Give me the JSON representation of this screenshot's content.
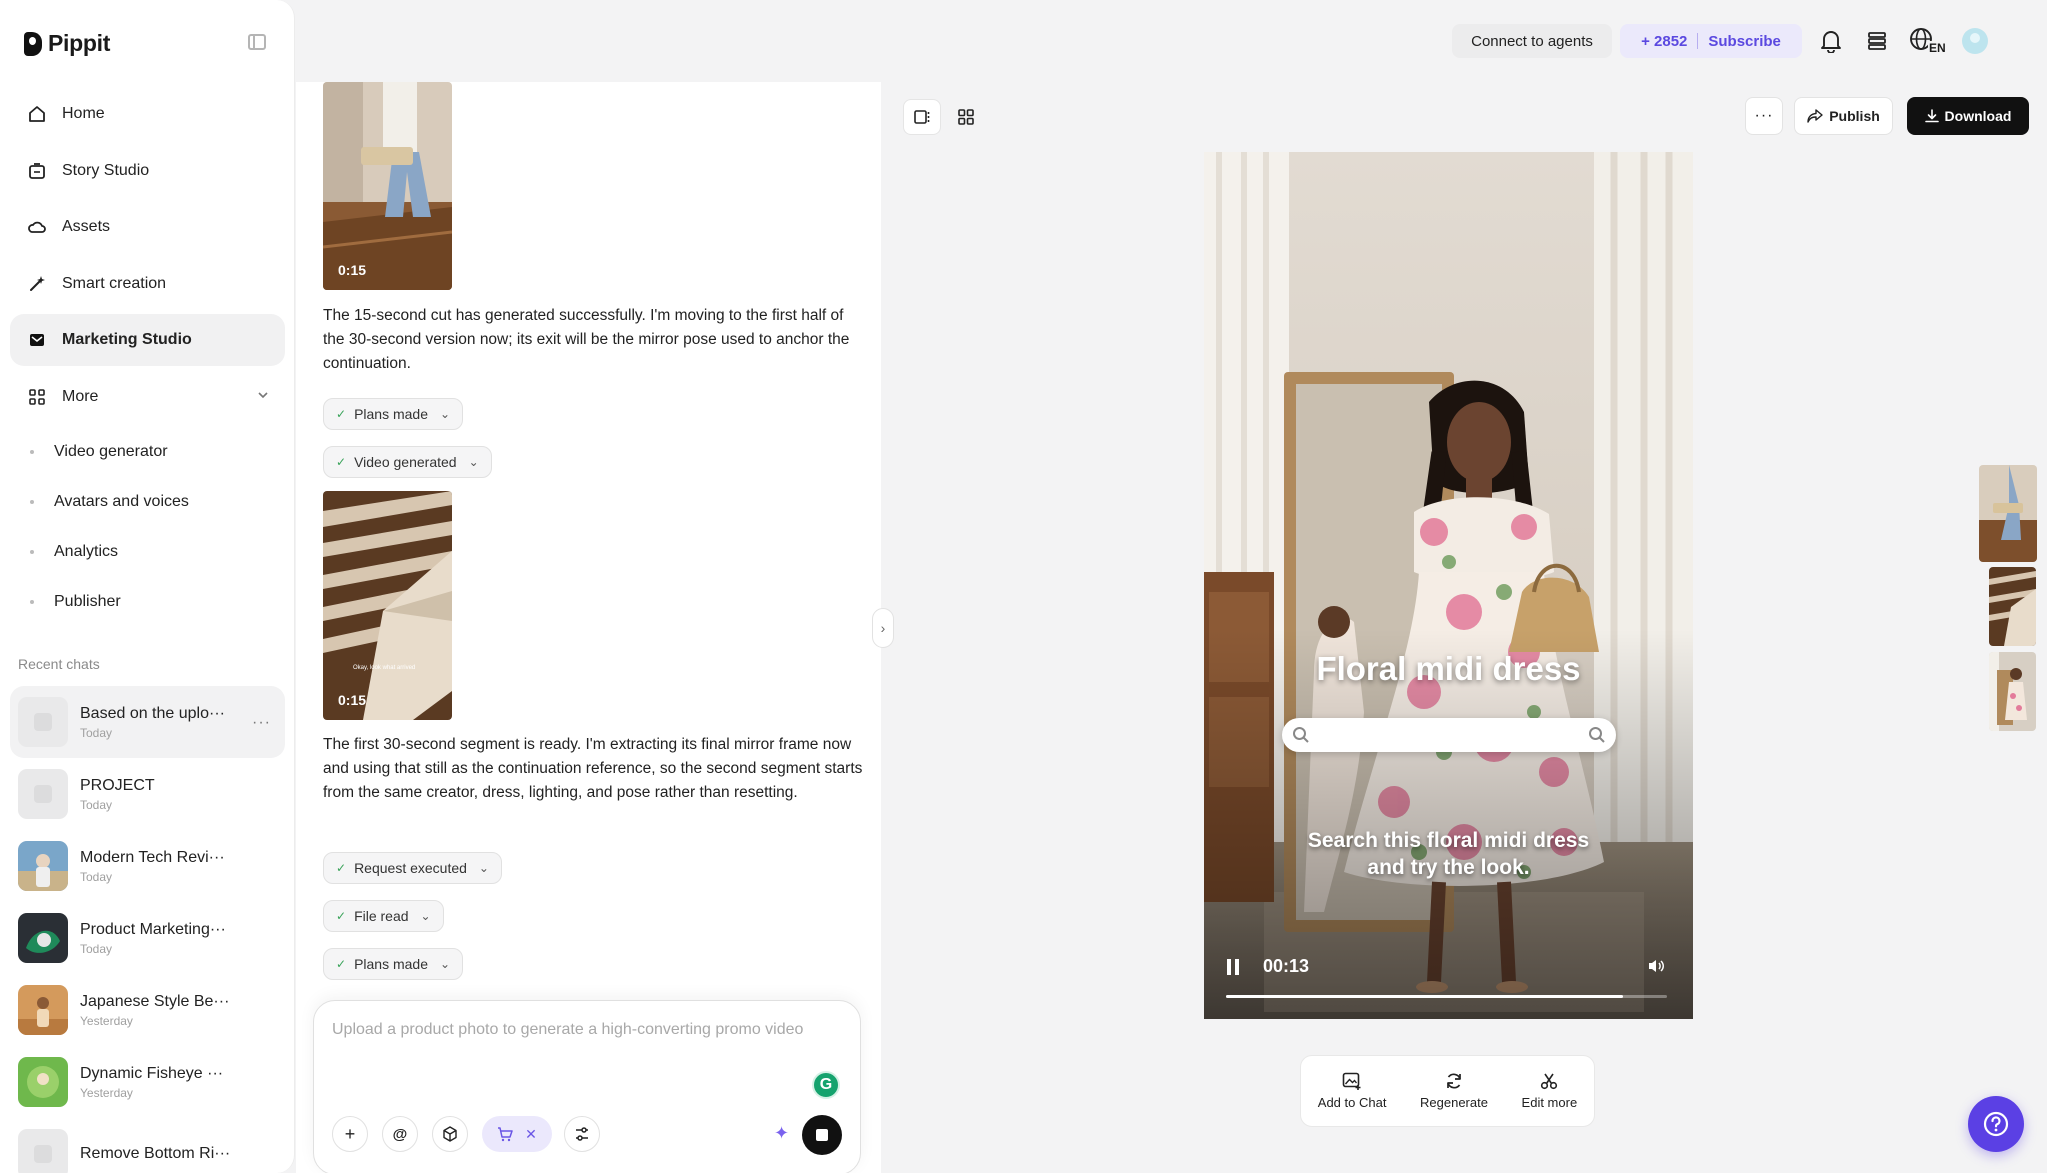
{
  "app": {
    "name": "Pippit"
  },
  "sidebar": {
    "items": [
      {
        "label": "Home",
        "icon": "home-icon"
      },
      {
        "label": "Story Studio",
        "icon": "story-icon"
      },
      {
        "label": "Assets",
        "icon": "cloud-icon"
      },
      {
        "label": "Smart creation",
        "icon": "magic-wand-icon"
      },
      {
        "label": "Marketing Studio",
        "icon": "mail-icon",
        "active": true
      },
      {
        "label": "More",
        "icon": "grid-icon"
      }
    ],
    "subitems": [
      {
        "label": "Video generator"
      },
      {
        "label": "Avatars and voices"
      },
      {
        "label": "Analytics"
      },
      {
        "label": "Publisher"
      }
    ],
    "recent_label": "Recent chats",
    "recent_chats": [
      {
        "title": "Based on the uplo···",
        "date": "Today",
        "active": true
      },
      {
        "title": "PROJECT",
        "date": "Today"
      },
      {
        "title": "Modern Tech Revi···",
        "date": "Today"
      },
      {
        "title": "Product Marketing···",
        "date": "Today"
      },
      {
        "title": "Japanese Style Be···",
        "date": "Yesterday"
      },
      {
        "title": "Dynamic Fisheye ···",
        "date": "Yesterday"
      },
      {
        "title": "Remove Bottom Ri···",
        "date": ""
      }
    ]
  },
  "topbar": {
    "connect_label": "Connect to agents",
    "credits": "+ 2852",
    "subscribe_label": "Subscribe",
    "lang": "EN"
  },
  "chat": {
    "videos": [
      {
        "duration": "0:15"
      },
      {
        "duration": "0:15",
        "overlay_text": "Okay, look what arrived"
      }
    ],
    "messages": [
      "The 15-second cut has generated successfully. I'm moving to the first half of the 30-second version now; its exit will be the mirror pose used to anchor the continuation.",
      "The first 30-second segment is ready. I'm extracting its final mirror frame now and using that still as the continuation reference, so the second segment starts from the same creator, dress, lighting, and pose rather than resetting."
    ],
    "pills": [
      {
        "label": "Plans made"
      },
      {
        "label": "Video generated"
      },
      {
        "label": "Request executed"
      },
      {
        "label": "File read"
      },
      {
        "label": "Plans made"
      }
    ],
    "composer_placeholder": "Upload a product photo to generate a high-converting promo video"
  },
  "preview": {
    "publish_label": "Publish",
    "download_label": "Download",
    "overlay_title": "Floral midi dress",
    "overlay_caption_line1": "Search this floral midi dress",
    "overlay_caption_line2": "and try the look.",
    "time": "00:13",
    "progress": 0.9,
    "actions": [
      {
        "label": "Add to Chat",
        "icon": "add-image-icon"
      },
      {
        "label": "Regenerate",
        "icon": "refresh-icon"
      },
      {
        "label": "Edit more",
        "icon": "scissors-icon"
      }
    ]
  },
  "colors": {
    "accent": "#5b40e4",
    "accent_soft": "#ebe9fb",
    "dark": "#111111"
  }
}
